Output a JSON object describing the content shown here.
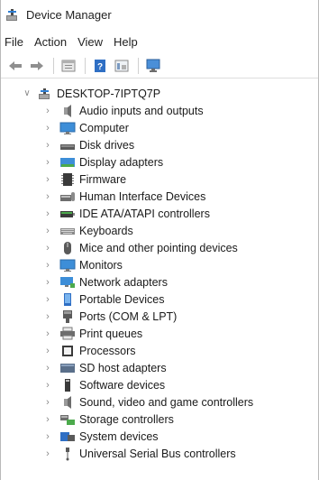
{
  "window": {
    "title": "Device Manager"
  },
  "menu": [
    "File",
    "Action",
    "View",
    "Help"
  ],
  "toolbar": {
    "icons": [
      "back-arrow-icon",
      "forward-arrow-icon",
      "properties-icon",
      "help-icon",
      "update-driver-icon",
      "scan-hardware-icon"
    ]
  },
  "tree": {
    "root": {
      "label": "DESKTOP-7IPTQ7P",
      "expander": "∨"
    },
    "collapsed_glyph": "›",
    "items": [
      {
        "label": "Audio inputs and outputs",
        "icon": "speaker-icon"
      },
      {
        "label": "Computer",
        "icon": "monitor-icon"
      },
      {
        "label": "Disk drives",
        "icon": "disk-drive-icon"
      },
      {
        "label": "Display adapters",
        "icon": "display-adapter-icon"
      },
      {
        "label": "Firmware",
        "icon": "firmware-chip-icon"
      },
      {
        "label": "Human Interface Devices",
        "icon": "hid-icon"
      },
      {
        "label": "IDE ATA/ATAPI controllers",
        "icon": "ide-controller-icon"
      },
      {
        "label": "Keyboards",
        "icon": "keyboard-icon"
      },
      {
        "label": "Mice and other pointing devices",
        "icon": "mouse-icon"
      },
      {
        "label": "Monitors",
        "icon": "monitor-icon"
      },
      {
        "label": "Network adapters",
        "icon": "network-adapter-icon"
      },
      {
        "label": "Portable Devices",
        "icon": "portable-device-icon"
      },
      {
        "label": "Ports (COM & LPT)",
        "icon": "port-icon"
      },
      {
        "label": "Print queues",
        "icon": "printer-icon"
      },
      {
        "label": "Processors",
        "icon": "processor-icon"
      },
      {
        "label": "SD host adapters",
        "icon": "sd-card-icon"
      },
      {
        "label": "Software devices",
        "icon": "software-device-icon"
      },
      {
        "label": "Sound, video and game controllers",
        "icon": "speaker-icon"
      },
      {
        "label": "Storage controllers",
        "icon": "storage-controller-icon"
      },
      {
        "label": "System devices",
        "icon": "system-device-icon"
      },
      {
        "label": "Universal Serial Bus controllers",
        "icon": "usb-icon"
      }
    ]
  },
  "colors": {
    "accent_blue": "#2f7fd4",
    "icon_gray": "#6d6d6d",
    "chevron": "#8a8a8a"
  }
}
